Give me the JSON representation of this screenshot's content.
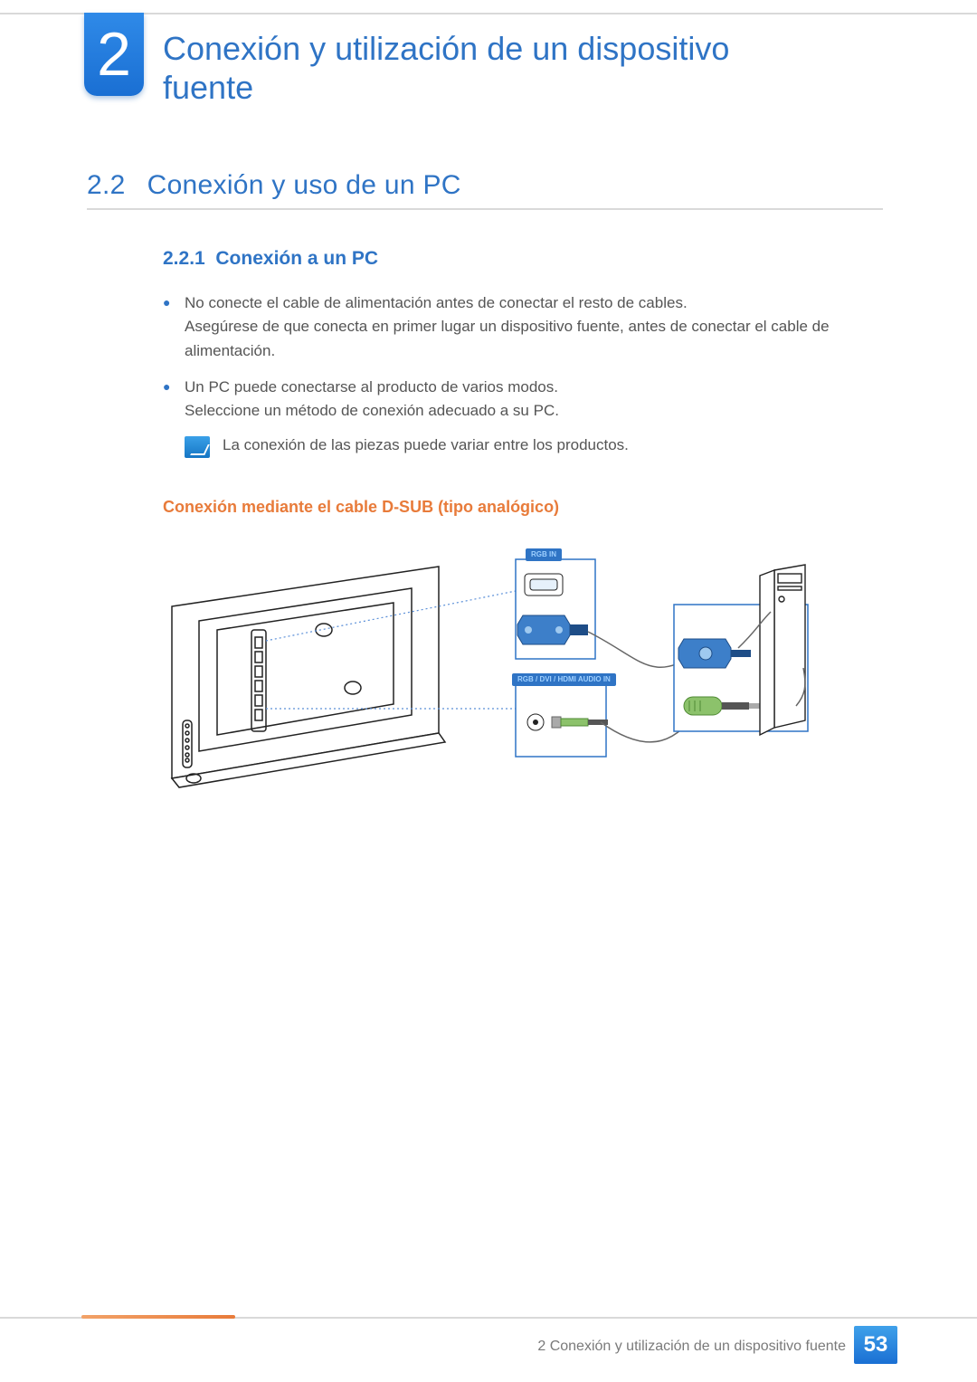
{
  "chapter": {
    "number": "2",
    "title": "Conexión y utilización de un dispositivo fuente"
  },
  "section": {
    "number": "2.2",
    "title": "Conexión y uso de un PC"
  },
  "subsection": {
    "number": "2.2.1",
    "title": "Conexión a un PC"
  },
  "bullets": [
    {
      "line1": "No conecte el cable de alimentación antes de conectar el resto de cables.",
      "line2": "Asegúrese de que conecta en primer lugar un dispositivo fuente, antes de conectar el cable de alimentación."
    },
    {
      "line1": "Un PC puede conectarse al producto de varios modos.",
      "line2": "Seleccione un método de conexión adecuado a su PC."
    }
  ],
  "note": "La conexión de las piezas puede variar entre los productos.",
  "subheading": "Conexión mediante el cable D-SUB (tipo analógico)",
  "diagram_labels": {
    "top": "RGB IN",
    "bottom": "RGB / DVI / HDMI AUDIO IN"
  },
  "footer": {
    "text": "2 Conexión y utilización de un dispositivo fuente",
    "page": "53"
  }
}
